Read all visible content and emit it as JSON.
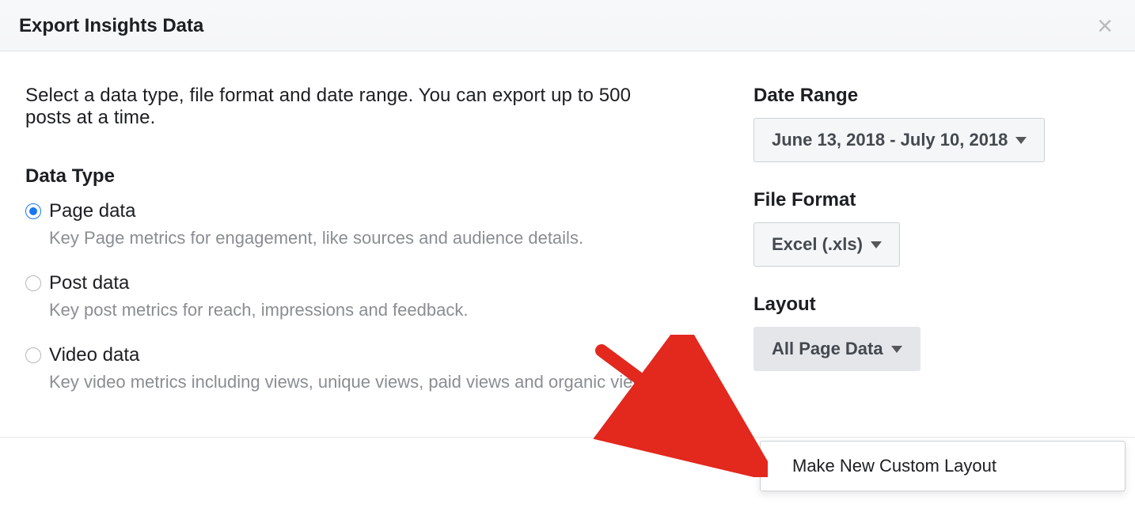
{
  "dialog": {
    "title": "Export Insights Data",
    "intro": "Select a data type, file format and date range. You can export up to 500 posts at a time."
  },
  "dataType": {
    "heading": "Data Type",
    "options": [
      {
        "label": "Page data",
        "desc": "Key Page metrics for engagement, like sources and audience details.",
        "selected": true
      },
      {
        "label": "Post data",
        "desc": "Key post metrics for reach, impressions and feedback.",
        "selected": false
      },
      {
        "label": "Video data",
        "desc": "Key video metrics including views, unique views, paid views and organic views.",
        "selected": false
      }
    ]
  },
  "dateRange": {
    "heading": "Date Range",
    "value": "June 13, 2018 - July 10, 2018"
  },
  "fileFormat": {
    "heading": "File Format",
    "value": "Excel (.xls)"
  },
  "layout": {
    "heading": "Layout",
    "value": "All Page Data",
    "popoverItem": "Make New Custom Layout"
  }
}
